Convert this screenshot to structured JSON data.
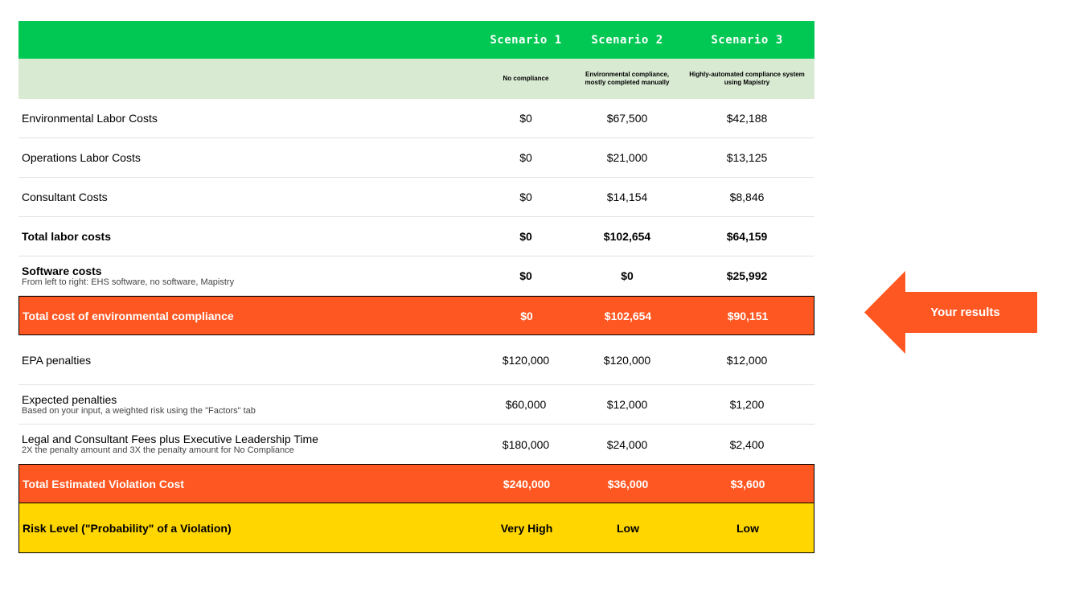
{
  "header": {
    "scenario1": "Scenario 1",
    "scenario2": "Scenario 2",
    "scenario3": "Scenario 3"
  },
  "subheader": {
    "scenario1": "No compliance",
    "scenario2": "Environmental compliance, mostly completed manually",
    "scenario3": "Highly-automated compliance system using Mapistry"
  },
  "rows": [
    {
      "label": "Environmental Labor Costs",
      "note": "",
      "v1": "$0",
      "v2": "$67,500",
      "v3": "$42,188"
    },
    {
      "label": "Operations Labor Costs",
      "note": "",
      "v1": "$0",
      "v2": "$21,000",
      "v3": "$13,125"
    },
    {
      "label": "Consultant Costs",
      "note": "",
      "v1": "$0",
      "v2": "$14,154",
      "v3": "$8,846"
    },
    {
      "label": "Total labor costs",
      "note": "",
      "v1": "$0",
      "v2": "$102,654",
      "v3": "$64,159"
    },
    {
      "label": "Software costs",
      "note": "From left to right: EHS software, no software, Mapistry",
      "v1": "$0",
      "v2": "$0",
      "v3": "$25,992"
    },
    {
      "label": "Total cost of environmental compliance",
      "note": "",
      "v1": "$0",
      "v2": "$102,654",
      "v3": "$90,151"
    },
    {
      "label": "EPA penalties",
      "note": "",
      "v1": "$120,000",
      "v2": "$120,000",
      "v3": "$12,000"
    },
    {
      "label": "Expected penalties",
      "note": "Based on your input, a weighted risk using the \"Factors\" tab",
      "v1": "$60,000",
      "v2": "$12,000",
      "v3": "$1,200"
    },
    {
      "label": "Legal and Consultant Fees plus Executive Leadership Time",
      "note": "2X the penalty amount and 3X the penalty amount for No Compliance",
      "v1": "$180,000",
      "v2": "$24,000",
      "v3": "$2,400"
    },
    {
      "label": "Total Estimated Violation Cost",
      "note": "",
      "v1": "$240,000",
      "v2": "$36,000",
      "v3": "$3,600"
    },
    {
      "label": "Risk Level (\"Probability\" of a Violation)",
      "note": "",
      "v1": "Very High",
      "v2": "Low",
      "v3": "Low"
    }
  ],
  "callout": {
    "label": "Your results",
    "color": "#ff5722"
  },
  "colors": {
    "header": "#00c853",
    "subheader": "#d9ead3",
    "highlight": "#ff5722",
    "risk": "#ffd600"
  }
}
